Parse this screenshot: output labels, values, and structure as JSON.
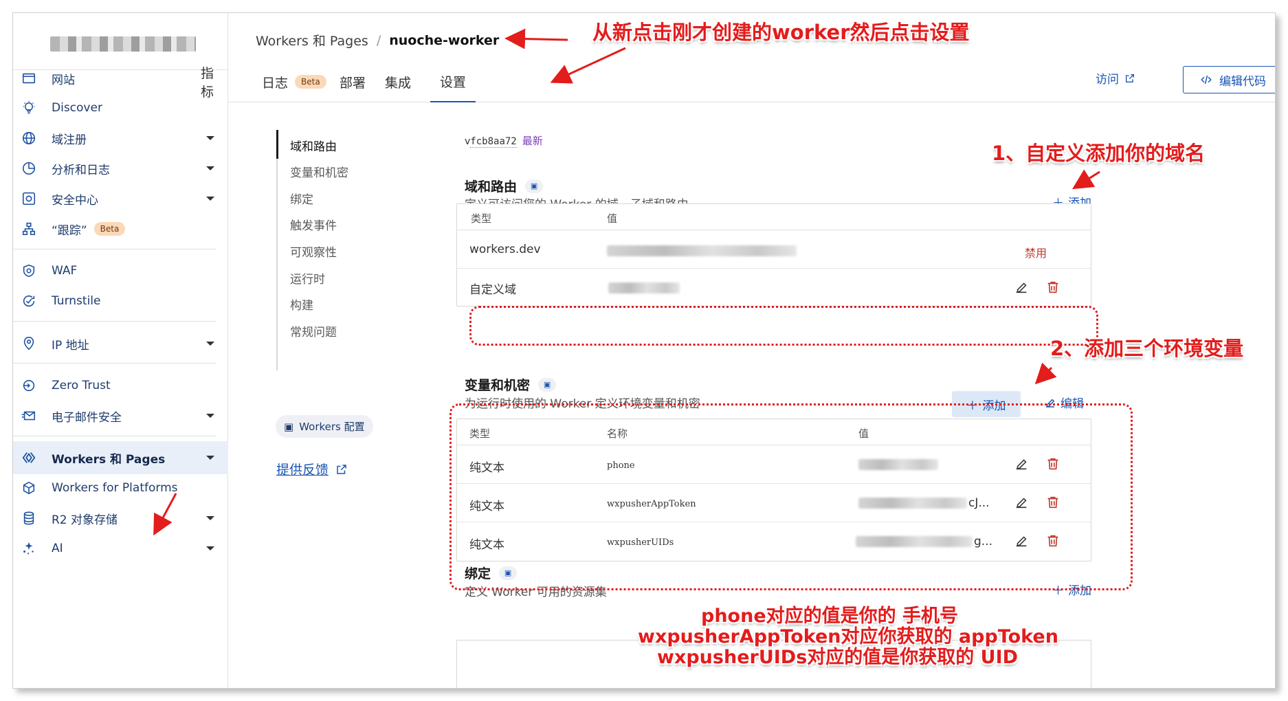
{
  "breadcrumb": {
    "parent": "Workers 和 Pages",
    "separator": "/",
    "current": "nuoche-worker"
  },
  "tabs": [
    {
      "label": "指标"
    },
    {
      "label": "日志",
      "badge": "Beta"
    },
    {
      "label": "部署"
    },
    {
      "label": "集成"
    },
    {
      "label": "设置"
    }
  ],
  "header_actions": {
    "visit": "访问",
    "edit_code": "编辑代码"
  },
  "sidebar": {
    "items": [
      {
        "label": "网站",
        "icon": "website-icon"
      },
      {
        "label": "Discover",
        "icon": "lightbulb-icon"
      },
      {
        "label": "域注册",
        "icon": "globe-icon"
      },
      {
        "label": "分析和日志",
        "icon": "chart-icon"
      },
      {
        "label": "安全中心",
        "icon": "security-icon"
      },
      {
        "label": "“跟踪”",
        "icon": "trace-icon",
        "badge": "Beta"
      },
      {
        "label": "WAF",
        "icon": "shield-icon"
      },
      {
        "label": "Turnstile",
        "icon": "turnstile-icon"
      },
      {
        "label": "IP 地址",
        "icon": "location-icon"
      },
      {
        "label": "Zero Trust",
        "icon": "zero-trust-icon"
      },
      {
        "label": "电子邮件安全",
        "icon": "email-icon"
      },
      {
        "label": "Workers 和 Pages",
        "icon": "workers-icon",
        "active": true
      },
      {
        "label": "Workers for Platforms",
        "icon": "cube-icon"
      },
      {
        "label": "R2 对象存储",
        "icon": "database-icon"
      },
      {
        "label": "AI",
        "icon": "sparkle-icon"
      }
    ]
  },
  "subnav": {
    "items": [
      "域和路由",
      "变量和机密",
      "绑定",
      "触发事件",
      "可观察性",
      "运行时",
      "构建",
      "常规问题"
    ],
    "workers_config": "Workers 配置",
    "feedback": "提供反馈"
  },
  "version": {
    "prefix": "v",
    "hash": "fcb8aa72",
    "tag": "最新"
  },
  "domains": {
    "title": "域和路由",
    "subtitle": "定义可访问您的 Worker 的域、子域和路由",
    "add": "添加",
    "columns": [
      "类型",
      "值"
    ],
    "rows": [
      {
        "type": "workers.dev",
        "action": "禁用"
      },
      {
        "type": "自定义域"
      }
    ]
  },
  "variables": {
    "title": "变量和机密",
    "subtitle": "为运行时使用的 Worker 定义环境变量和机密",
    "add": "添加",
    "edit": "编辑",
    "columns": [
      "类型",
      "名称",
      "值"
    ],
    "rows": [
      {
        "type": "纯文本",
        "name": "phone",
        "value_tail": ""
      },
      {
        "type": "纯文本",
        "name": "wxpusherAppToken",
        "value_tail": "cJ..."
      },
      {
        "type": "纯文本",
        "name": "wxpusherUIDs",
        "value_tail": "g..."
      }
    ]
  },
  "bindings": {
    "title": "绑定",
    "subtitle": "定义 Worker 可用的资源集",
    "add": "添加"
  },
  "annotations": {
    "top": "从新点击刚才创建的worker然后点击设置",
    "step1": "1、自定义添加你的域名",
    "step2": "2、添加三个环境变量",
    "note_line1": "phone对应的值是你的 手机号",
    "note_line2": "wxpusherAppToken对应你获取的 appToken",
    "note_line3": "wxpusherUIDs对应的值是你获取的 UID"
  },
  "colors": {
    "accent": "#1a55b3",
    "annotation": "#e31c1c",
    "danger": "#c0392b",
    "beta_bg": "#fbd8b8"
  }
}
